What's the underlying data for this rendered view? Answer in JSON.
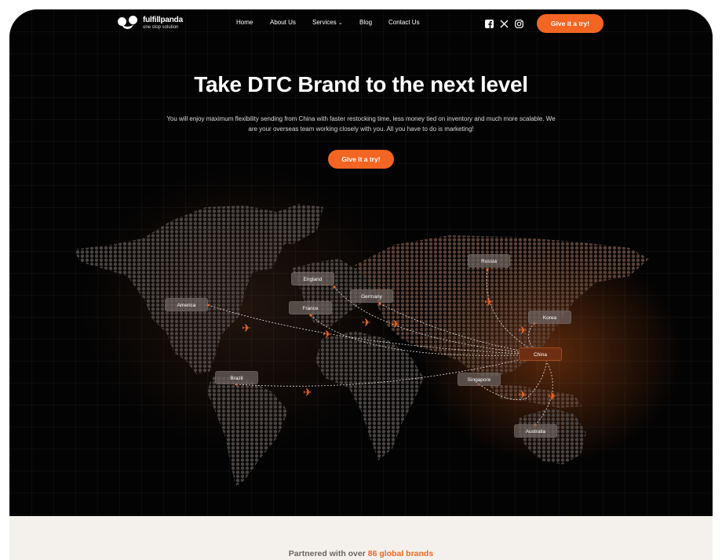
{
  "header": {
    "logo_name": "fulfillpanda",
    "logo_tagline": "one stop solution",
    "nav": [
      {
        "label": "Home"
      },
      {
        "label": "About Us"
      },
      {
        "label": "Services"
      },
      {
        "label": "Blog"
      },
      {
        "label": "Contact Us"
      }
    ],
    "services_chevron": "⌄",
    "social_icons": [
      "facebook-icon",
      "x-icon",
      "instagram-icon"
    ],
    "cta_label": "Give it a try!"
  },
  "hero": {
    "title": "Take DTC Brand to the next level",
    "subtitle": "You will enjoy maximum flexibility sending from China with faster restocking time, less money tied on inventory and much more scalable. We are your overseas team working closely with you. All you have to do is marketing!",
    "cta_label": "Give it a try!"
  },
  "map": {
    "locations": [
      {
        "name": "Russia"
      },
      {
        "name": "England"
      },
      {
        "name": "Germany"
      },
      {
        "name": "America"
      },
      {
        "name": "France"
      },
      {
        "name": "Korea"
      },
      {
        "name": "China"
      },
      {
        "name": "Brazil"
      },
      {
        "name": "Singapore"
      },
      {
        "name": "Australia"
      }
    ],
    "hub": "China",
    "accent_color": "#f26522"
  },
  "partners": {
    "prefix": "Partnered with over ",
    "highlight": "86 global brands"
  }
}
